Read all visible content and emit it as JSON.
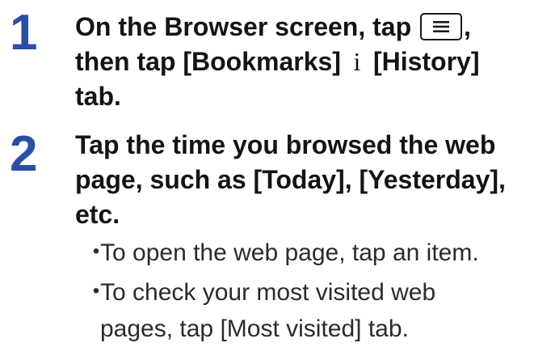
{
  "steps": [
    {
      "number": "1",
      "text_a": "On the Browser screen, tap ",
      "menu_key_icon": "menu-key-icon",
      "text_b": ",",
      "text_c": "then tap [Bookmarks]",
      "separator": "i",
      "text_d": "[History]",
      "text_e": "tab."
    },
    {
      "number": "2",
      "line1": "Tap the time you browsed the web",
      "line2": "page, such as [Today], [Yesterday],",
      "line3": "etc."
    }
  ],
  "bullets": [
    {
      "marker": "・",
      "line1": "To open the web page, tap an item."
    },
    {
      "marker": "・",
      "line1": "To check your most visited web",
      "line2": "pages, tap [Most visited] tab."
    }
  ],
  "colors": {
    "step_number": "#2a4fa3",
    "text": "#141414"
  }
}
